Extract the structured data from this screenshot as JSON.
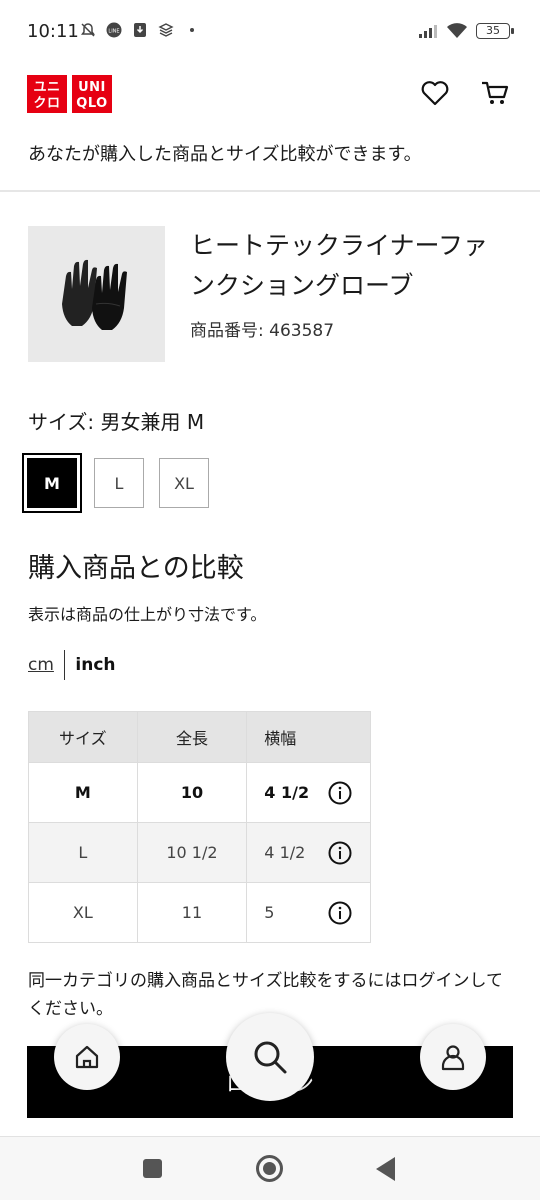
{
  "status_bar": {
    "time": "10:11",
    "battery": "35",
    "icons": [
      "mute-bell-icon",
      "line-app-icon",
      "download-icon",
      "layers-icon",
      "dot-icon",
      "signal-icon",
      "wifi-icon",
      "battery-icon"
    ]
  },
  "header": {
    "logo_top": "ユニ\nクロ",
    "logo_bottom": "UNI\nQLO",
    "icons": [
      "heart-icon",
      "cart-icon"
    ]
  },
  "notice": "あなたが購入した商品とサイズ比較ができます。",
  "product": {
    "name": "ヒートテックライナーファンクショングローブ",
    "number_label": "商品番号: ",
    "number_value": "463587"
  },
  "size_select": {
    "label": "サイズ: ",
    "value": "男女兼用 M",
    "options": [
      "M",
      "L",
      "XL"
    ],
    "selected": "M"
  },
  "compare": {
    "title": "購入商品との比較",
    "note": "表示は商品の仕上がり寸法です。",
    "unit_cm": "cm",
    "unit_inch": "inch",
    "selected_unit": "inch"
  },
  "table": {
    "headers": [
      "サイズ",
      "全長",
      "横幅"
    ],
    "rows": [
      {
        "size": "M",
        "length": "10",
        "width": "4 1/2"
      },
      {
        "size": "L",
        "length": "10 1/2",
        "width": "4 1/2"
      },
      {
        "size": "XL",
        "length": "11",
        "width": "5"
      }
    ]
  },
  "login_note": "同一カテゴリの購入商品とサイズ比較をするにはログインしてください。",
  "login_button": "ログイン",
  "colors": {
    "brand_red": "#e60012",
    "button_black": "#000000",
    "table_header": "#e4e4e4"
  }
}
